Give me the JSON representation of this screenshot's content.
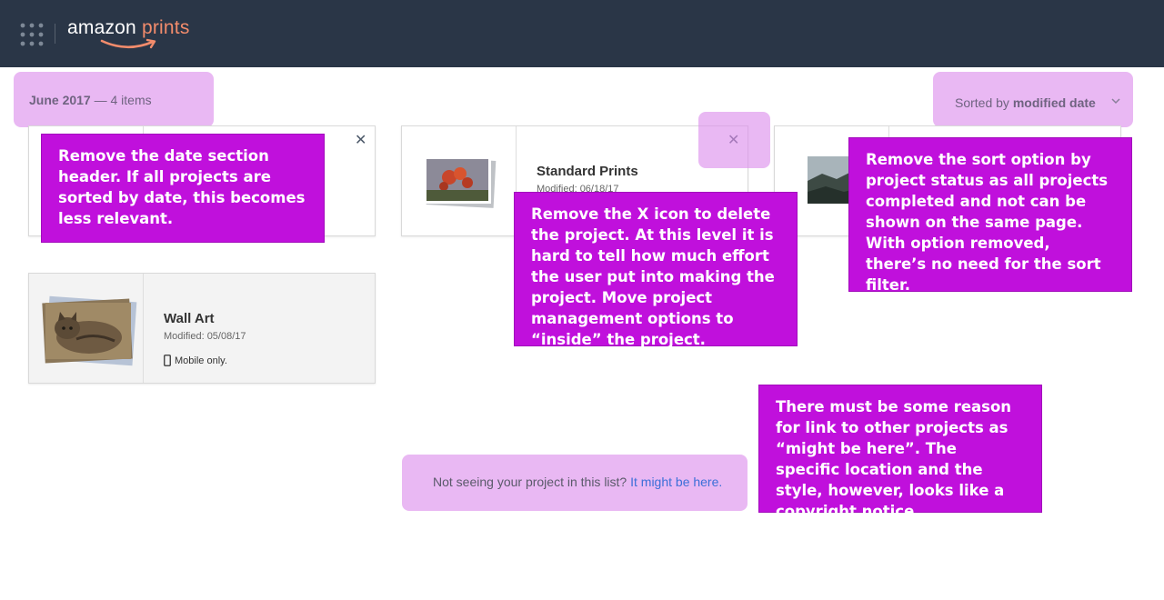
{
  "header": {
    "logo_word1": "amazon",
    "logo_word2": "prints",
    "bg_color": "#2a3647",
    "accent_color": "#f28c6c"
  },
  "section": {
    "month": "June 2017",
    "count": "— 4 items"
  },
  "sort": {
    "prefix": "Sorted by",
    "value": "modified date"
  },
  "projects": [
    {
      "title": "Standard Prints",
      "modified": "Modified: 06/18/17"
    },
    {
      "title": "Wall Art",
      "modified": "Modified: 05/08/17",
      "note": "Mobile only."
    }
  ],
  "footer": {
    "text": "Not seeing your project in this list?",
    "link": "It might be here."
  },
  "annotations": [
    "Remove the date section header. If all projects are sorted by date, this becomes less relevant.",
    "Remove the X icon to delete the project. At this level it is hard to tell how much effort the user put into making the project. Move project management options to “inside” the project.",
    "Remove the sort option by project status as all projects completed and not can be shown on the same page. With option removed, there’s no need for the sort filter.",
    "There must be some reason for link to other projects as “might be here”. The specific location and the style, however, looks like a copyright notice"
  ],
  "colors": {
    "highlight": "#dc8ceb",
    "annotation": "#c010dc",
    "link": "#3c6fd8"
  },
  "icons": [
    "apps-grid-icon",
    "amazon-smile-icon",
    "close-icon",
    "chevron-down-icon",
    "mobile-phone-icon"
  ]
}
